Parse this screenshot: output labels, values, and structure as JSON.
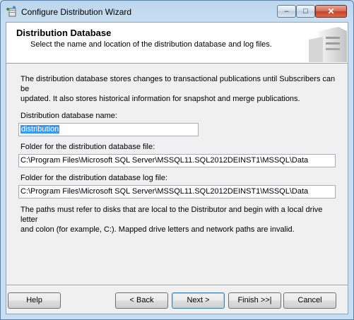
{
  "window": {
    "title": "Configure Distribution Wizard",
    "controls": {
      "minimize": "–",
      "maximize": "□",
      "close": "✕"
    }
  },
  "header": {
    "title": "Distribution Database",
    "subtitle": "Select the name and location of the distribution database and log files."
  },
  "main": {
    "description_line1": "The distribution database stores changes to transactional publications until Subscribers can be",
    "description_line2": "updated. It also stores historical information for snapshot and merge publications.",
    "db_name_label": "Distribution database name:",
    "db_name_value": "distribution",
    "data_folder_label": "Folder for the distribution database file:",
    "data_folder_value": "C:\\Program Files\\Microsoft SQL Server\\MSSQL11.SQL2012DEINST1\\MSSQL\\Data",
    "log_folder_label": "Folder for the distribution database log file:",
    "log_folder_value": "C:\\Program Files\\Microsoft SQL Server\\MSSQL11.SQL2012DEINST1\\MSSQL\\Data",
    "note_line1": "The paths must refer to disks that are local to the Distributor and begin with a local drive letter",
    "note_line2": "and colon (for example, C:). Mapped drive letters and network paths are invalid."
  },
  "buttons": {
    "help": "Help",
    "back": "< Back",
    "next": "Next >",
    "finish": "Finish >>|",
    "cancel": "Cancel"
  },
  "icons": {
    "app": "wizard-app-icon",
    "header_graphic": "server-graphic-icon"
  }
}
